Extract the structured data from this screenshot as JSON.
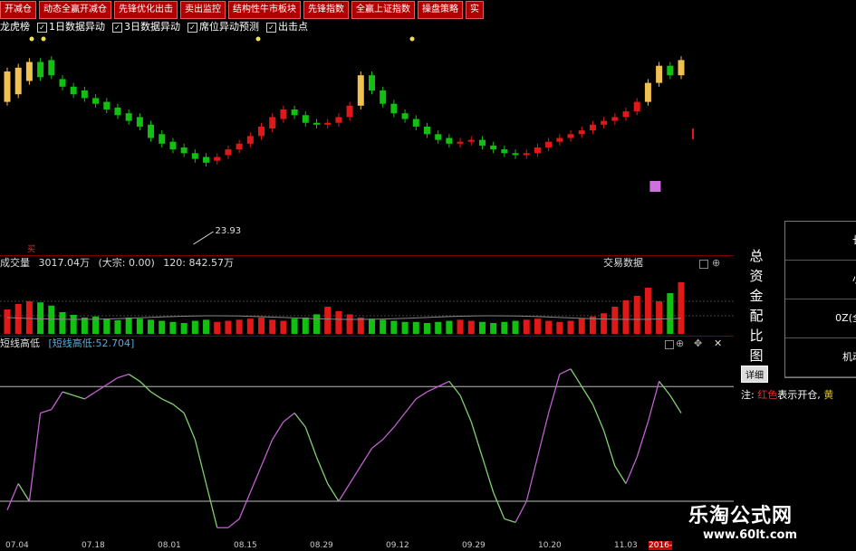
{
  "toolbar": {
    "buttons": [
      "开减仓",
      "动态全赢开减仓",
      "先锋优化出击",
      "卖出监控",
      "结构性牛市板块",
      "先锋指数",
      "全赢上证指数",
      "操盘策略",
      "实"
    ]
  },
  "checks": [
    {
      "label": "龙虎榜",
      "checked": false
    },
    {
      "label": "1日数据异动",
      "checked": true
    },
    {
      "label": "3日数据异动",
      "checked": true
    },
    {
      "label": "席位异动预测",
      "checked": true
    },
    {
      "label": "出击点",
      "checked": true
    }
  ],
  "main_chart": {
    "min_price_label": "23.93",
    "buy_marker": "买"
  },
  "volume_panel": {
    "label": "成交量",
    "value": "3017.04万",
    "dazong": "(大宗: 0.00)",
    "ma": "120: 842.57万",
    "right_label": "交易数据"
  },
  "osc_panel": {
    "name": "短线高低",
    "indicator": "[短线高低:52.704]"
  },
  "dates": [
    "07.04",
    "07.18",
    "08.01",
    "08.15",
    "08.29",
    "09.12",
    "09.29",
    "10.20",
    "11.03",
    "2016-"
  ],
  "right_panel": {
    "title": "总资金配比图",
    "detail_button": "详细",
    "table": [
      "长",
      "小",
      "0Z(全",
      "机动"
    ],
    "note_prefix": "注:",
    "note_red": "红色",
    "note_text": "表示开仓,",
    "note_yellow": "黄"
  },
  "watermark": {
    "line1": "乐淘公式网",
    "line2": "www.60lt.com"
  },
  "colors": {
    "up": "#e01818",
    "down": "#12c012",
    "gold": "#f0c050",
    "osc_green": "#80d070",
    "osc_purple": "#c060d0"
  },
  "chart_data": {
    "type": "candlestick",
    "candles": [
      [
        0.74,
        0.9
      ],
      [
        0.78,
        0.92
      ],
      [
        0.85,
        0.95
      ],
      [
        0.95,
        0.87
      ],
      [
        0.96,
        0.88
      ],
      [
        0.86,
        0.82
      ],
      [
        0.82,
        0.78
      ],
      [
        0.8,
        0.76
      ],
      [
        0.76,
        0.73
      ],
      [
        0.74,
        0.7
      ],
      [
        0.71,
        0.67
      ],
      [
        0.68,
        0.64
      ],
      [
        0.66,
        0.61
      ],
      [
        0.62,
        0.55
      ],
      [
        0.57,
        0.52
      ],
      [
        0.53,
        0.49
      ],
      [
        0.5,
        0.47
      ],
      [
        0.47,
        0.44
      ],
      [
        0.45,
        0.42
      ],
      [
        0.43,
        0.45
      ],
      [
        0.46,
        0.49
      ],
      [
        0.49,
        0.52
      ],
      [
        0.52,
        0.56
      ],
      [
        0.56,
        0.61
      ],
      [
        0.6,
        0.66
      ],
      [
        0.65,
        0.7
      ],
      [
        0.7,
        0.67
      ],
      [
        0.67,
        0.63
      ],
      [
        0.63,
        0.62
      ],
      [
        0.62,
        0.63
      ],
      [
        0.63,
        0.66
      ],
      [
        0.66,
        0.72
      ],
      [
        0.72,
        0.88
      ],
      [
        0.88,
        0.8
      ],
      [
        0.8,
        0.73
      ],
      [
        0.73,
        0.68
      ],
      [
        0.68,
        0.65
      ],
      [
        0.65,
        0.61
      ],
      [
        0.61,
        0.57
      ],
      [
        0.57,
        0.54
      ],
      [
        0.55,
        0.52
      ],
      [
        0.52,
        0.53
      ],
      [
        0.53,
        0.54
      ],
      [
        0.54,
        0.51
      ],
      [
        0.51,
        0.49
      ],
      [
        0.49,
        0.47
      ],
      [
        0.47,
        0.46
      ],
      [
        0.46,
        0.47
      ],
      [
        0.47,
        0.5
      ],
      [
        0.5,
        0.53
      ],
      [
        0.53,
        0.55
      ],
      [
        0.55,
        0.57
      ],
      [
        0.57,
        0.59
      ],
      [
        0.59,
        0.62
      ],
      [
        0.62,
        0.64
      ],
      [
        0.64,
        0.66
      ],
      [
        0.66,
        0.69
      ],
      [
        0.69,
        0.74
      ],
      [
        0.74,
        0.84
      ],
      [
        0.84,
        0.93
      ],
      [
        0.93,
        0.88
      ],
      [
        0.88,
        0.96
      ]
    ],
    "volume": [
      0.45,
      0.55,
      0.6,
      0.58,
      0.52,
      0.4,
      0.35,
      0.3,
      0.32,
      0.28,
      0.25,
      0.3,
      0.28,
      0.26,
      0.24,
      0.22,
      0.2,
      0.24,
      0.26,
      0.22,
      0.24,
      0.26,
      0.28,
      0.3,
      0.26,
      0.24,
      0.28,
      0.3,
      0.36,
      0.5,
      0.42,
      0.36,
      0.3,
      0.28,
      0.26,
      0.24,
      0.22,
      0.22,
      0.2,
      0.22,
      0.24,
      0.26,
      0.24,
      0.22,
      0.2,
      0.22,
      0.24,
      0.26,
      0.28,
      0.24,
      0.22,
      0.24,
      0.28,
      0.32,
      0.38,
      0.5,
      0.62,
      0.7,
      0.85,
      0.6,
      0.75,
      0.95
    ],
    "osc_main": [
      0.15,
      0.3,
      0.2,
      0.7,
      0.72,
      0.82,
      0.8,
      0.78,
      0.82,
      0.86,
      0.9,
      0.92,
      0.88,
      0.82,
      0.78,
      0.75,
      0.7,
      0.55,
      0.3,
      0.05,
      0.05,
      0.1,
      0.25,
      0.4,
      0.55,
      0.65,
      0.7,
      0.62,
      0.45,
      0.3,
      0.2,
      0.3,
      0.4,
      0.5,
      0.55,
      0.62,
      0.7,
      0.78,
      0.82,
      0.85,
      0.88,
      0.8,
      0.65,
      0.45,
      0.25,
      0.1,
      0.08,
      0.2,
      0.45,
      0.7,
      0.92,
      0.95,
      0.85,
      0.75,
      0.6,
      0.4,
      0.3,
      0.45,
      0.65,
      0.88,
      0.8,
      0.7
    ],
    "osc_ref_lines": [
      0.85,
      0.2
    ]
  }
}
